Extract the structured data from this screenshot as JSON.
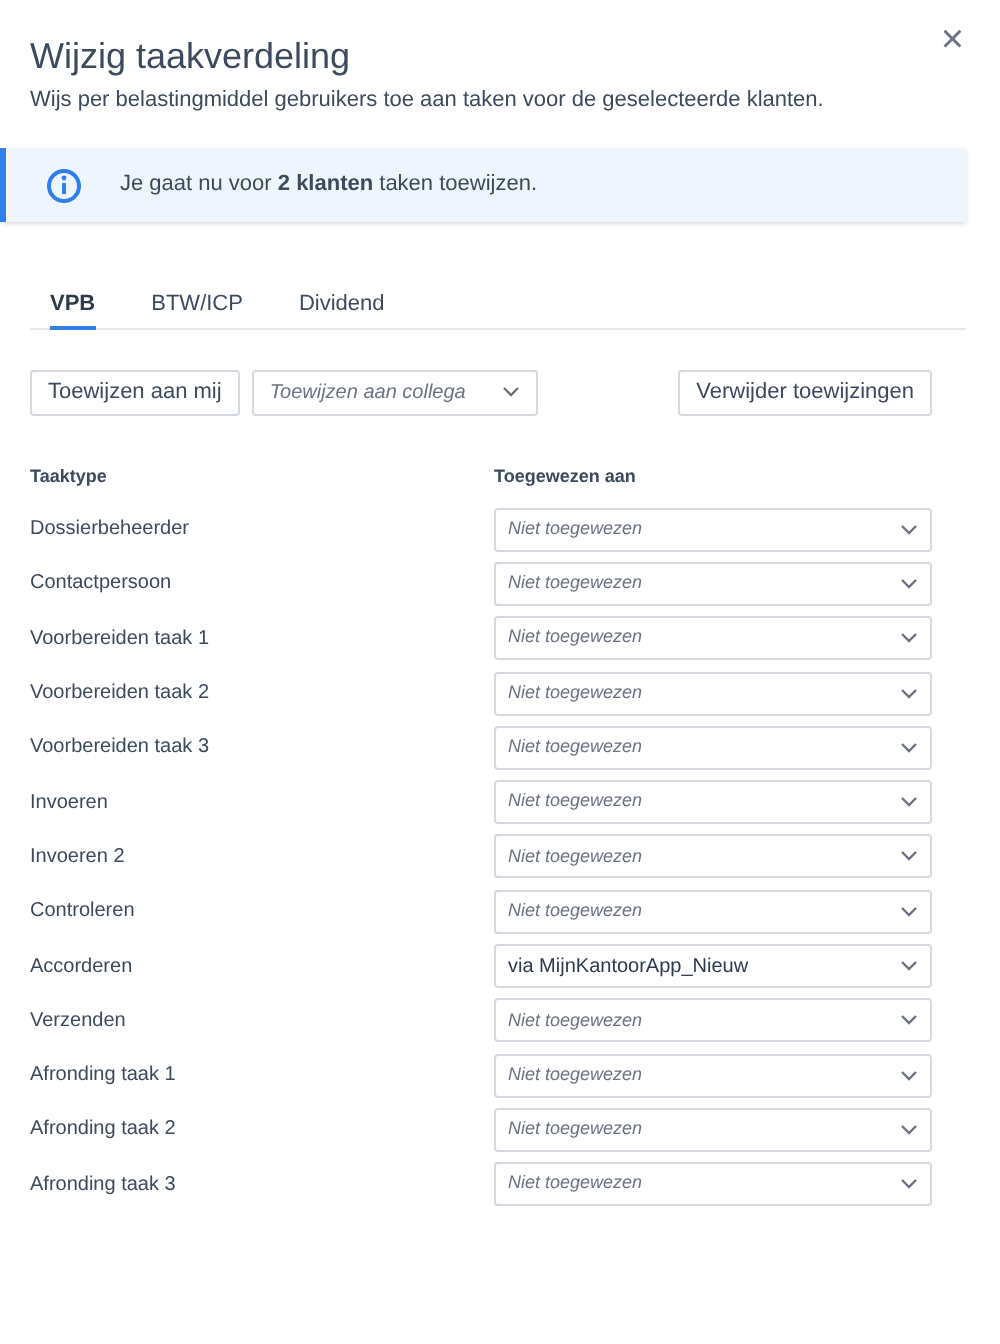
{
  "dialog": {
    "title": "Wijzig taakverdeling",
    "subtitle": "Wijs per belastingmiddel gebruikers toe aan taken voor de geselecteerde klanten.",
    "close": "×"
  },
  "info": {
    "text": "Je gaat nu voor **2 klanten** taken toewijzen."
  },
  "tabs": [
    {
      "label": "VPB",
      "selected": true
    },
    {
      "label": "BTW/ICP",
      "selected": false
    },
    {
      "label": "Dividend",
      "selected": false
    }
  ],
  "toolbar": {
    "assign_me": "Toewijzen aan mij",
    "assign_colleague": {
      "placeholder": "Toewijzen aan collega"
    },
    "remove": "Verwijder toewijzingen"
  },
  "table": {
    "columns": [
      "Taaktype",
      "Toegewezen aan"
    ],
    "rows": [
      {
        "task": "Dossierbeheerder",
        "assigned": {
          "placeholder": "Niet toegewezen"
        }
      },
      {
        "task": "Contactpersoon",
        "assigned": {
          "placeholder": "Niet toegewezen"
        }
      },
      {
        "task": "Voorbereiden taak 1",
        "assigned": {
          "placeholder": "Niet toegewezen"
        }
      },
      {
        "task": "Voorbereiden taak 2",
        "assigned": {
          "placeholder": "Niet toegewezen"
        }
      },
      {
        "task": "Voorbereiden taak 3",
        "assigned": {
          "placeholder": "Niet toegewezen"
        }
      },
      {
        "task": "Invoeren",
        "assigned": {
          "placeholder": "Niet toegewezen"
        }
      },
      {
        "task": "Invoeren 2",
        "assigned": {
          "placeholder": "Niet toegewezen"
        }
      },
      {
        "task": "Controleren",
        "assigned": {
          "placeholder": "Niet toegewezen"
        }
      },
      {
        "task": "Accorderen",
        "assigned": {
          "value": "via MijnKantoorApp_Nieuw"
        }
      },
      {
        "task": "Verzenden",
        "assigned": {
          "placeholder": "Niet toegewezen"
        }
      },
      {
        "task": "Afronding taak 1",
        "assigned": {
          "placeholder": "Niet toegewezen"
        }
      },
      {
        "task": "Afronding taak 2",
        "assigned": {
          "placeholder": "Niet toegewezen"
        }
      },
      {
        "task": "Afronding taak 3",
        "assigned": {
          "placeholder": "Niet toegewezen"
        }
      }
    ]
  }
}
